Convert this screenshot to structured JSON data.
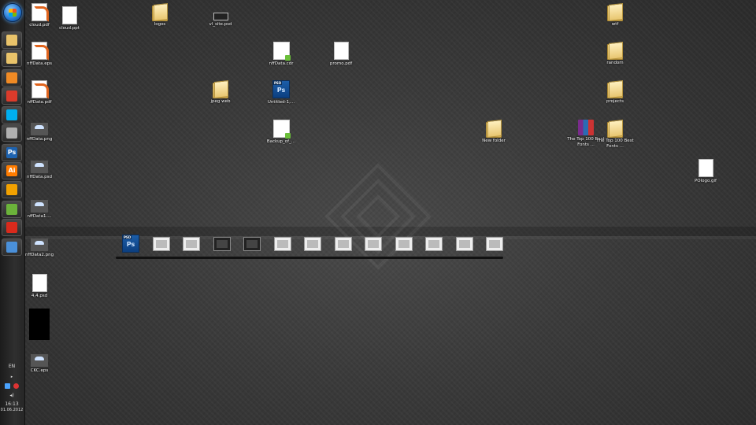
{
  "taskbar": {
    "pinned": [
      {
        "name": "folder",
        "color": "#e9c36a"
      },
      {
        "name": "folder",
        "color": "#e9c36a"
      },
      {
        "name": "media-player",
        "color": "#f08a24"
      },
      {
        "name": "chrome",
        "color": "#db3b2b"
      },
      {
        "name": "skype",
        "color": "#00aff0"
      },
      {
        "name": "paint",
        "color": "#b0b0b0"
      },
      {
        "name": "photoshop",
        "color": "#1e63b0",
        "label": "Ps"
      },
      {
        "name": "illustrator",
        "color": "#ff7c00",
        "label": "Ai"
      },
      {
        "name": "pen-tool",
        "color": "#f2a100"
      },
      {
        "name": "evernote",
        "color": "#6bb33a"
      },
      {
        "name": "acrobat",
        "color": "#d92a1c"
      },
      {
        "name": "app",
        "color": "#4a90d9"
      }
    ],
    "language": "EN",
    "time": "16:13",
    "date": "01.06.2012"
  },
  "desktop": {
    "icons": [
      {
        "label": "cloud.pdf",
        "type": "pdf"
      },
      {
        "label": "cloud.ppt",
        "type": "ppt"
      },
      {
        "label": "logos",
        "type": "folder"
      },
      {
        "label": "vl_site.psd",
        "type": "psd-thumb"
      },
      {
        "label": "wtf",
        "type": "folder"
      },
      {
        "label": "nffData.eps",
        "type": "eps"
      },
      {
        "label": "nffData.cdr",
        "type": "cdr"
      },
      {
        "label": "promo.pdf",
        "type": "doc"
      },
      {
        "label": "random",
        "type": "folder"
      },
      {
        "label": "nffData.pdf",
        "type": "pdf"
      },
      {
        "label": "jpeg web",
        "type": "folder"
      },
      {
        "label": "Untitled-1,...",
        "type": "psd"
      },
      {
        "label": "projects",
        "type": "folder"
      },
      {
        "label": "nffData.png",
        "type": "cloud"
      },
      {
        "label": "Backup_of_...",
        "type": "cdr"
      },
      {
        "label": "New folder",
        "type": "folder"
      },
      {
        "label": "The Top 100 Best Fonts ...",
        "type": "rar"
      },
      {
        "label": "The Top 100 Best Fonts ...",
        "type": "folder"
      },
      {
        "label": "nffData.psd",
        "type": "cloud"
      },
      {
        "label": "POlogo.gif",
        "type": "doc"
      },
      {
        "label": "nffData1....",
        "type": "cloud"
      },
      {
        "label": "nffData2.png",
        "type": "cloud"
      },
      {
        "label": "4,4.psd",
        "type": "doc"
      },
      {
        "label": "",
        "type": "black"
      },
      {
        "label": "CKC.eps",
        "type": "cloud"
      }
    ]
  },
  "strip": {
    "items": [
      {
        "type": "psd"
      },
      {
        "type": "light"
      },
      {
        "type": "light"
      },
      {
        "type": "dark"
      },
      {
        "type": "dark"
      },
      {
        "type": "light"
      },
      {
        "type": "light"
      },
      {
        "type": "light"
      },
      {
        "type": "light"
      },
      {
        "type": "light"
      },
      {
        "type": "light"
      },
      {
        "type": "light"
      },
      {
        "type": "light"
      }
    ]
  }
}
